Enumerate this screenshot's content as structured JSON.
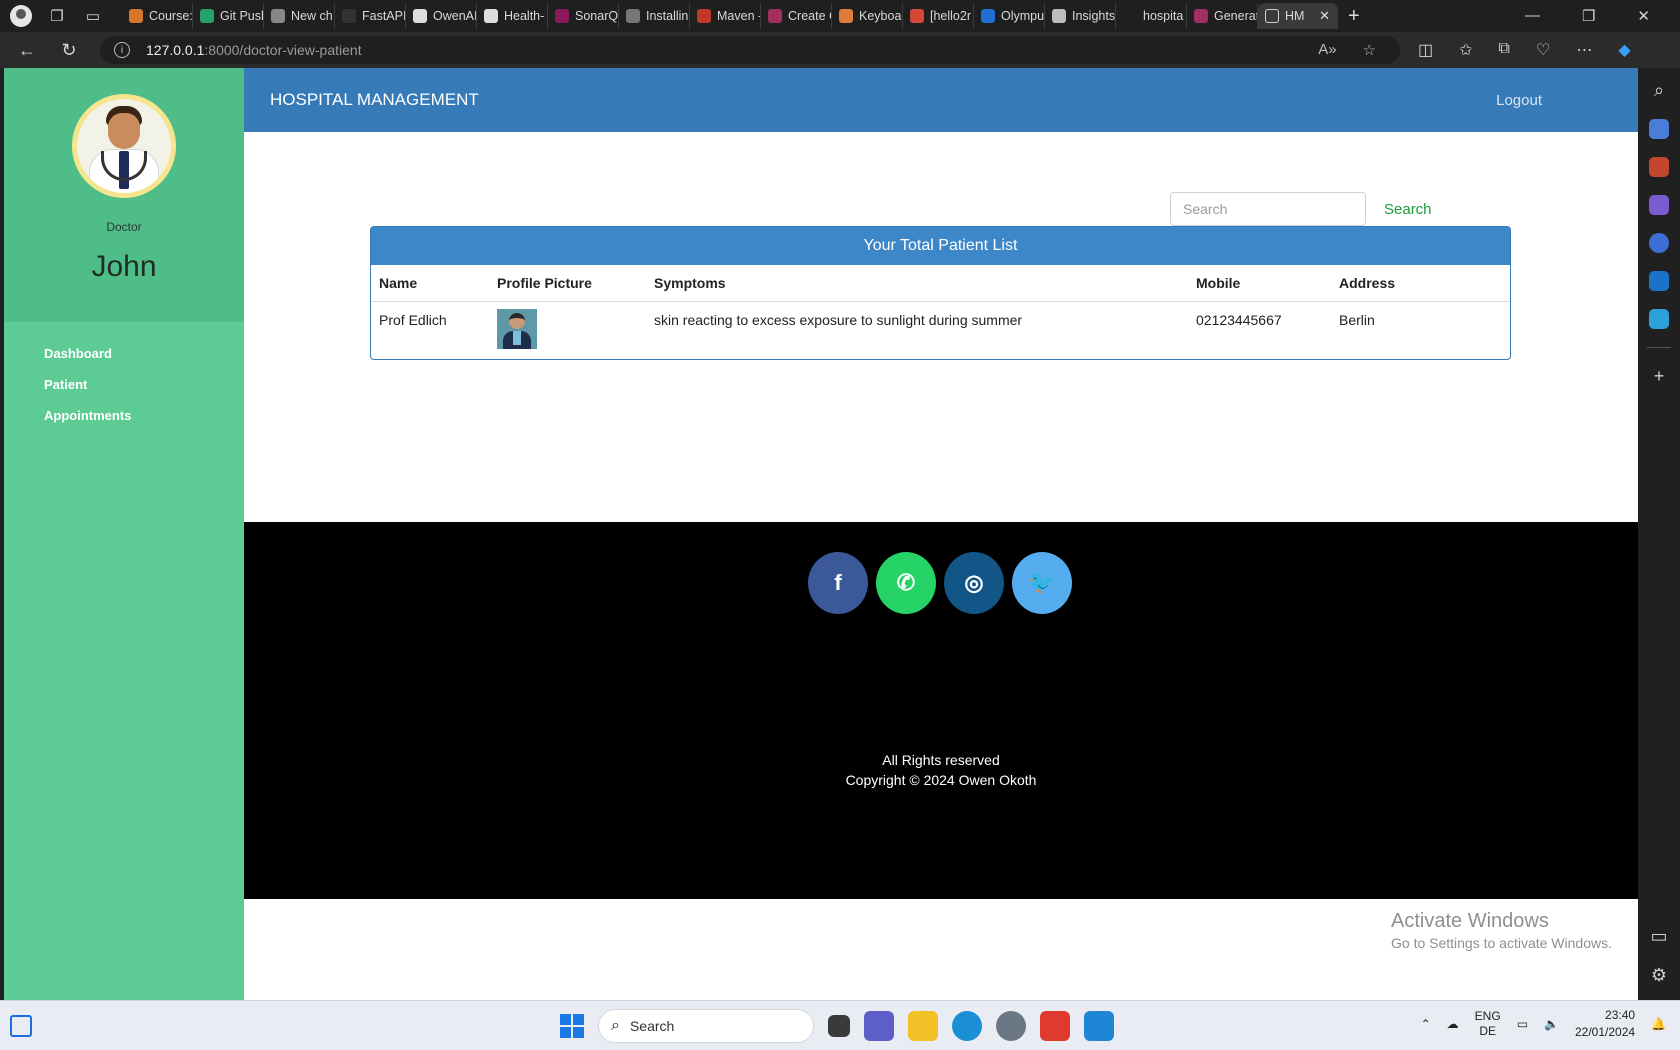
{
  "browser": {
    "tabs": [
      {
        "label": "Course:",
        "color": "#d4772b"
      },
      {
        "label": "Git Push",
        "color": "#21a366"
      },
      {
        "label": "New ch",
        "color": "#888888"
      },
      {
        "label": "FastAPI",
        "color": "#333333"
      },
      {
        "label": "OwenAI",
        "color": "#dddddd"
      },
      {
        "label": "Health-",
        "color": "#dddddd"
      },
      {
        "label": "SonarQ",
        "color": "#8a1a5a"
      },
      {
        "label": "Installin",
        "color": "#777777"
      },
      {
        "label": "Maven -",
        "color": "#c0392b"
      },
      {
        "label": "Create C",
        "color": "#a03060"
      },
      {
        "label": "Keyboar",
        "color": "#e07b39"
      },
      {
        "label": "[hello2r",
        "color": "#d44638"
      },
      {
        "label": "Olympu",
        "color": "#1f6fd1"
      },
      {
        "label": "Insights",
        "color": "#bbbbbb"
      },
      {
        "label": "hospita",
        "color": "#1f1f1f"
      },
      {
        "label": "Generat",
        "color": "#a03060"
      }
    ],
    "active_tab": {
      "label": "HM",
      "close": "✕"
    },
    "new_tab": "+",
    "url_host": "127.0.0.1",
    "url_path": ":8000/doctor-view-patient"
  },
  "sidebar": {
    "role": "Doctor",
    "name": "John",
    "links": [
      "Dashboard",
      "Patient",
      "Appointments"
    ]
  },
  "topnav": {
    "brand": "HOSPITAL MANAGEMENT",
    "logout": "Logout"
  },
  "search": {
    "placeholder": "Search",
    "button": "Search"
  },
  "patients": {
    "title": "Your Total Patient List",
    "columns": [
      "Name",
      "Profile Picture",
      "Symptoms",
      "Mobile",
      "Address"
    ],
    "rows": [
      {
        "name": "Prof Edlich",
        "symptoms": "skin reacting to excess exposure to sunlight during summer",
        "mobile": "02123445667",
        "address": "Berlin"
      }
    ]
  },
  "footer": {
    "socials": [
      {
        "name": "facebook",
        "glyph": "f",
        "color": "#3b5998"
      },
      {
        "name": "whatsapp",
        "glyph": "✆",
        "color": "#25d366"
      },
      {
        "name": "instagram",
        "glyph": "◎",
        "color": "#125688"
      },
      {
        "name": "twitter",
        "glyph": "🐦",
        "color": "#55acee"
      }
    ],
    "rights": "All Rights reserved",
    "copyright": "Copyright © 2024 Owen Okoth"
  },
  "watermark": {
    "title": "Activate Windows",
    "subtitle": "Go to Settings to activate Windows."
  },
  "taskbar": {
    "search_label": "Search",
    "lang_line1": "ENG",
    "lang_line2": "DE",
    "time": "23:40",
    "date": "22/01/2024"
  }
}
